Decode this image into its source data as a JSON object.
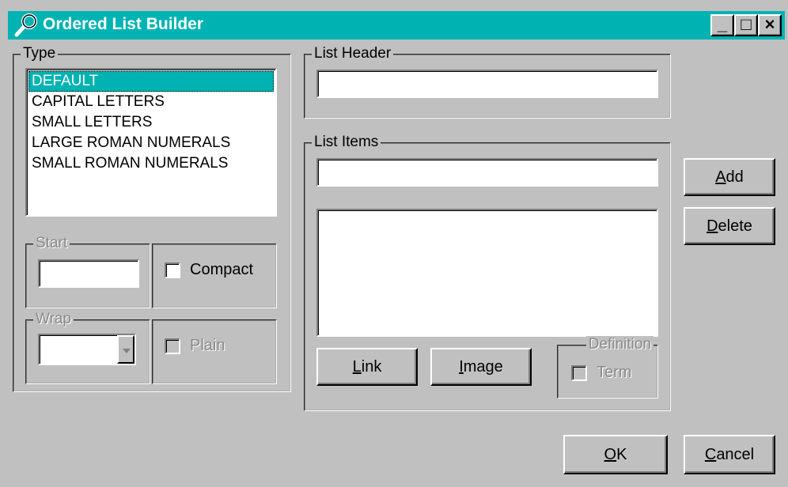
{
  "window": {
    "title": "Ordered List Builder",
    "controls": {
      "minimize": "_",
      "maximize": "□",
      "close": "×"
    },
    "accent": "#00b3b3"
  },
  "type_group": {
    "label": "Type",
    "items": [
      "DEFAULT",
      "CAPITAL LETTERS",
      "SMALL LETTERS",
      "LARGE ROMAN NUMERALS",
      "SMALL ROMAN NUMERALS"
    ],
    "selected": "DEFAULT"
  },
  "start_group": {
    "label": "Start",
    "value": ""
  },
  "compact": {
    "label": "Compact",
    "checked": false
  },
  "wrap_group": {
    "label": "Wrap",
    "value": ""
  },
  "plain": {
    "label": "Plain",
    "checked": false
  },
  "list_header": {
    "label": "List Header",
    "value": ""
  },
  "list_items": {
    "label": "List Items",
    "input_value": ""
  },
  "buttons": {
    "add": "Add",
    "delete": "Delete",
    "link": "Link",
    "image": "Image",
    "ok": "OK",
    "cancel": "Cancel"
  },
  "definition_group": {
    "label": "Definition",
    "term_label": "Term"
  }
}
